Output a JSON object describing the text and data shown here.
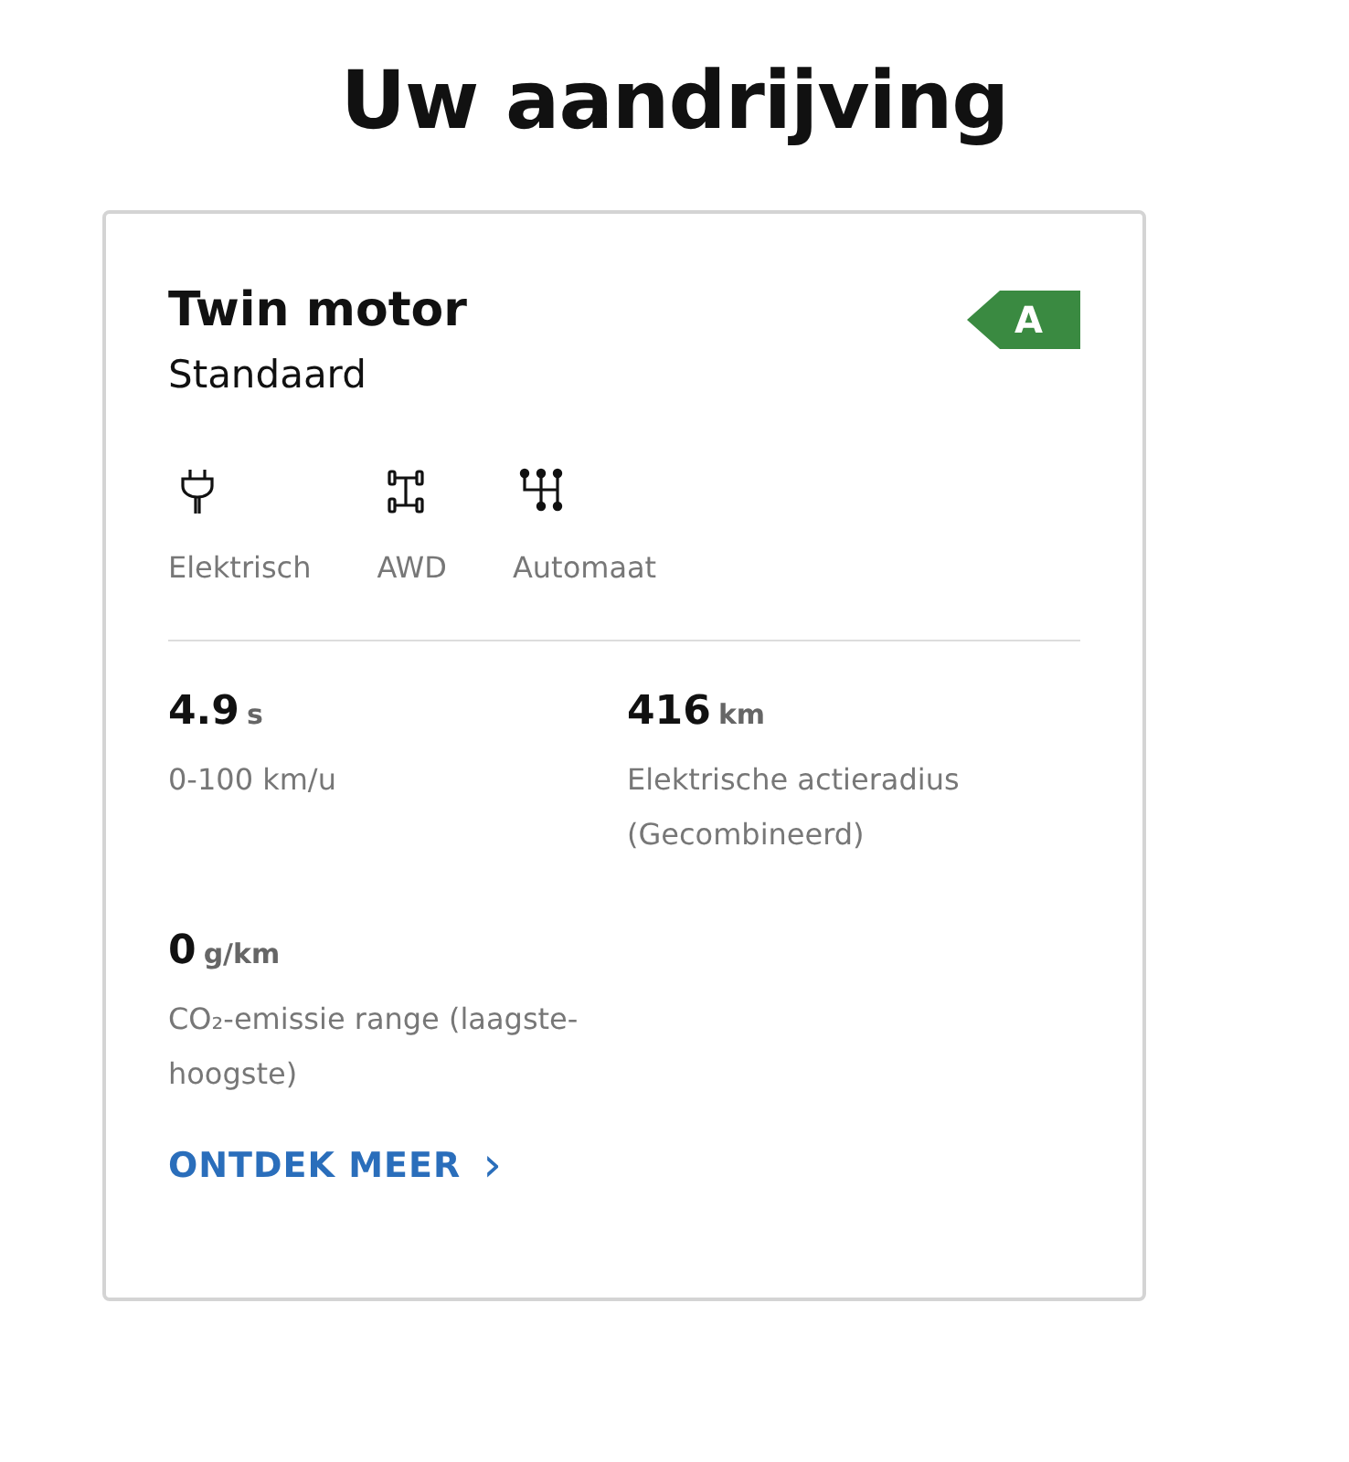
{
  "heading": "Uw aandrijving",
  "card": {
    "title": "Twin motor",
    "subtitle": "Standaard",
    "energy_label": {
      "text": "A",
      "color": "#3a8a41"
    },
    "features": [
      {
        "kind": "plug",
        "label": "Elektrisch"
      },
      {
        "kind": "axle",
        "label": "AWD"
      },
      {
        "kind": "gearshift",
        "label": "Automaat"
      }
    ],
    "stats": [
      {
        "value": "4.9",
        "unit": "s",
        "label_lines": [
          "0-100 km/u"
        ]
      },
      {
        "value": "416",
        "unit": "km",
        "label_lines": [
          "Elektrische actieradius",
          "(Gecombineerd)"
        ]
      },
      {
        "value": "0",
        "unit": "g/km",
        "label_lines": [
          "CO₂-emissie range (laagste-",
          "hoogste)"
        ]
      }
    ],
    "link": {
      "label": "ONTDEK MEER",
      "icon": "›"
    }
  }
}
